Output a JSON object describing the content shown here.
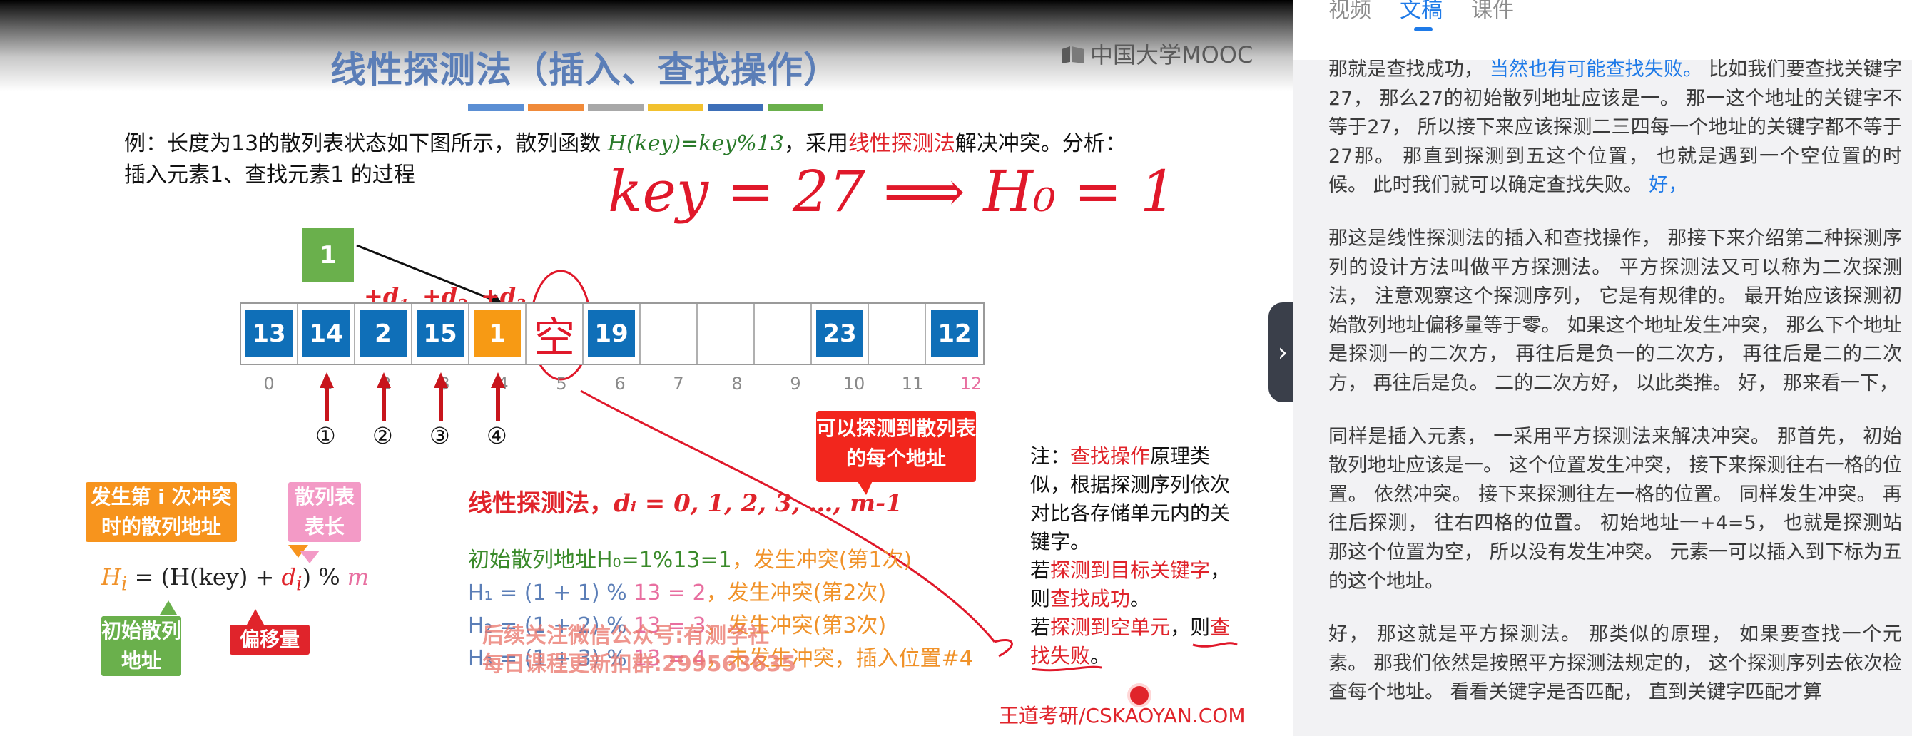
{
  "slide": {
    "title": "线性探测法（插入、查找操作）",
    "logo_text": "中国大学MOOC",
    "strip_colors": [
      "#5b8fd4",
      "#f08a3a",
      "#a8a8a8",
      "#f2c12e",
      "#3d6fb8",
      "#6ab04c"
    ],
    "problem_line1_a": "例：长度为13的散列表状态如下图所示，散列函数 ",
    "problem_fn": "H(key)=key%13",
    "problem_line1_b": "，采用",
    "problem_method": "线性探测法",
    "problem_line1_c": "解决冲突。分析：",
    "problem_line2": "插入元素1、查找元素1 的过程",
    "handwriting": "key = 27 ⟹ H₀ = 1",
    "new_element": "1",
    "d_labels": [
      "+d",
      "+d",
      "+d"
    ],
    "d_subs": [
      "1",
      "2",
      "3"
    ],
    "table_cells": [
      {
        "value": "13",
        "style": "blue"
      },
      {
        "value": "14",
        "style": "blue"
      },
      {
        "value": "2",
        "style": "blue"
      },
      {
        "value": "15",
        "style": "blue"
      },
      {
        "value": "1",
        "style": "orange"
      },
      {
        "value": "空",
        "style": "hand"
      },
      {
        "value": "19",
        "style": "blue"
      },
      {
        "value": "",
        "style": "empty"
      },
      {
        "value": "",
        "style": "empty"
      },
      {
        "value": "",
        "style": "empty"
      },
      {
        "value": "23",
        "style": "blue"
      },
      {
        "value": "",
        "style": "empty"
      },
      {
        "value": "12",
        "style": "blue"
      }
    ],
    "indices": [
      "0",
      "1",
      "2",
      "3",
      "4",
      "5",
      "6",
      "7",
      "8",
      "9",
      "10",
      "11",
      "12"
    ],
    "circled_steps": [
      "①",
      "②",
      "③",
      "④"
    ],
    "callout_detect": "可以探测到散列表的每个地址",
    "tag_conflict": "发生第 i 次冲突时的散列地址",
    "tag_table_len": "散列表表长",
    "tag_initial": "初始散列地址",
    "tag_offset": "偏移量",
    "formula_hi": "Hᵢ = (H(key) + dᵢ) % m",
    "lp_heading_a": "线性探测法，",
    "lp_heading_b": "dᵢ = 0, 1, 2, 3, …, m-1",
    "steps": [
      {
        "a": "初始散列地址H₀=1%13=1",
        "b": "，发生冲突(第1次)"
      },
      {
        "a": "H₁ = (1 + 1) % ",
        "p": "13 = 2",
        "b": "，发生冲突(第2次)"
      },
      {
        "a": "H₂ = (1 + 2) % ",
        "p": "13 = 3",
        "b": "，发生冲突(第3次)"
      },
      {
        "a": "H₃ = (1 + 3) % ",
        "p": "13 = 4",
        "b": "，未发生冲突，插入位置#4"
      }
    ],
    "note_a": "注：",
    "note_b": "查找操作",
    "note_c": "原理类似，根据探测序列依次对比各存储单元内的关键字。",
    "note_d": "若",
    "note_e": "探测到目标关键字",
    "note_f": "，则",
    "note_g": "查找成功",
    "note_h": "。",
    "note_i": "若",
    "note_j": "探测到空单元",
    "note_k": "，则",
    "note_l": "查找失败",
    "note_m": "。",
    "watermark_1": "后续关注微信公众号:有测学社",
    "watermark_2": "每日课程更新扣群:299563635",
    "brand": "王道考研/CSKAOYAN.COM"
  },
  "panel": {
    "tabs": [
      {
        "label": "视频",
        "active": false
      },
      {
        "label": "文稿",
        "active": true
      },
      {
        "label": "课件",
        "active": false
      }
    ],
    "p1_a": "那就是查找成功，",
    "p1_hl": "当然也有可能查找失败。",
    "p1_b": "比如我们要查找关键字27， 那么27的初始散列地址应该是一。 那一这个地址的关键字不等于27， 所以接下来应该探测二三四每一个地址的关键字都不等于27那。 那直到探测到五这个位置， 也就是遇到一个空位置的时候。 此时我们就可以确定查找失败。",
    "p1_hl2": "好，",
    "p2": "那这是线性探测法的插入和查找操作， 那接下来介绍第二种探测序列的设计方法叫做平方探测法。 平方探测法又可以称为二次探测法， 注意观察这个探测序列， 它是有规律的。 最开始应该探测初始散列地址偏移量等于零。 如果这个地址发生冲突， 那么下个地址是探测一的二次方， 再往后是负一的二次方， 再往后是二的二次方， 再往后是负。 二的二次方好， 以此类推。 好， 那来看一下，",
    "p3": "同样是插入元素， 一采用平方探测法来解决冲突。 那首先， 初始散列地址应该是一。 这个位置发生冲突， 接下来探测往右一格的位置。 依然冲突。 接下来探测往左一格的位置。 同样发生冲突。 再往后探测， 往右四格的位置。 初始地址一+4=5， 也就是探测站那这个位置为空， 所以没有发生冲突。 元素一可以插入到下标为五的这个地址。",
    "p4": "好， 那这就是平方探测法。 那类似的原理， 如果要查找一个元素。 那我们依然是按照平方探测法规定的， 这个探测序列去依次检查每个地址。 看看关键字是否匹配， 直到关键字匹配才算"
  }
}
